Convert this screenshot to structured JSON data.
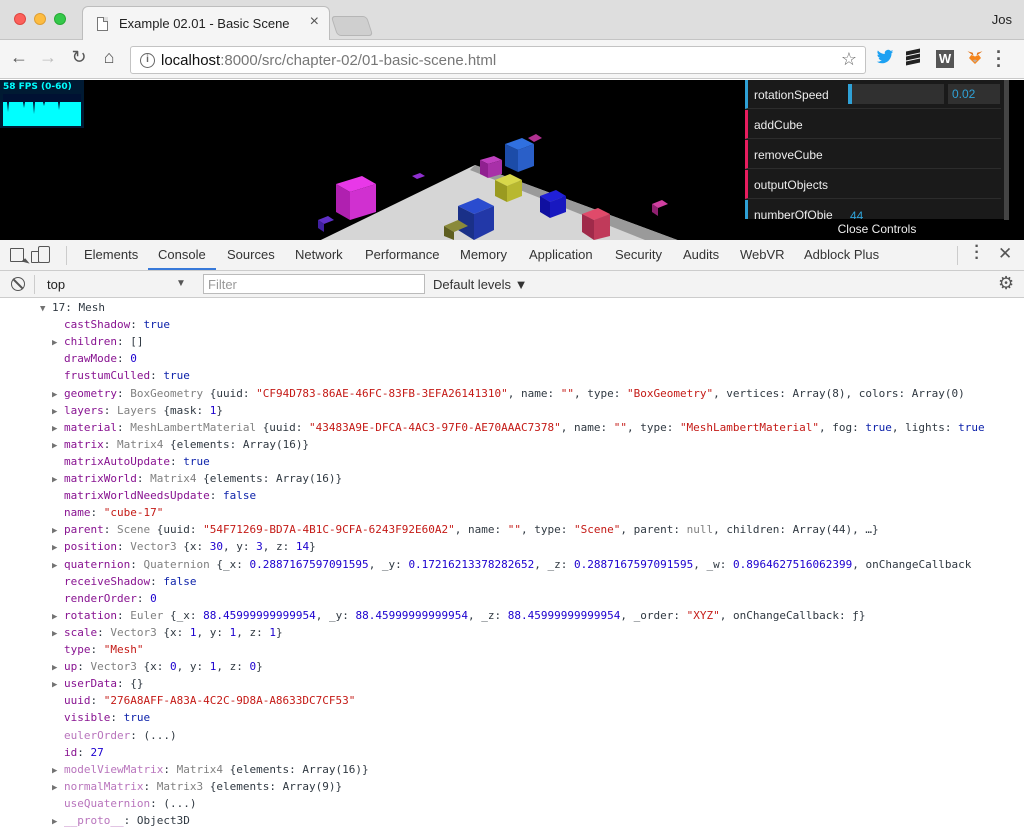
{
  "window": {
    "tab_title": "Example 02.01 - Basic Scene",
    "tab_close": "×",
    "profile": "Jos"
  },
  "toolbar": {
    "back": "←",
    "forward": "→",
    "reload": "↻",
    "home": "⌂",
    "url_host": "localhost",
    "url_rest": ":8000/src/chapter-02/01-basic-scene.html",
    "info": "i",
    "star": "☆",
    "ext_w": "W",
    "menu": "⋮"
  },
  "stats": {
    "fps_label": "58 FPS (0-60)"
  },
  "gui": {
    "rows": [
      {
        "label": "rotationSpeed",
        "type": "number",
        "value": "0.02",
        "fill": 0.04
      },
      {
        "label": "addCube",
        "type": "function"
      },
      {
        "label": "removeCube",
        "type": "function"
      },
      {
        "label": "outputObjects",
        "type": "function"
      },
      {
        "label": "numberOfObje",
        "type": "number",
        "value": "44"
      }
    ],
    "close_label": "Close Controls",
    "colors": {
      "number": "#2fa1d6",
      "function": "#e61d5f"
    }
  },
  "devtools": {
    "tabs": [
      "Elements",
      "Console",
      "Sources",
      "Network",
      "Performance",
      "Memory",
      "Application",
      "Security",
      "Audits",
      "WebVR",
      "Adblock Plus"
    ],
    "active_tab": "Console",
    "more": "⋮",
    "close": "✕"
  },
  "console_bar": {
    "context": "top",
    "context_arrow": "▼",
    "filter_placeholder": "Filter",
    "levels": "Default levels ▼",
    "gear": "⚙"
  },
  "console_lines": [
    {
      "indent": 40,
      "arrow": "▼",
      "parts": [
        [
          "t",
          "17: Mesh"
        ]
      ]
    },
    {
      "indent": 52,
      "arrow": "",
      "parts": [
        [
          "k",
          "castShadow"
        ],
        [
          "t",
          ": "
        ],
        [
          "b",
          "true"
        ]
      ]
    },
    {
      "indent": 52,
      "arrow": "▶",
      "parts": [
        [
          "k",
          "children"
        ],
        [
          "t",
          ": []"
        ]
      ]
    },
    {
      "indent": 52,
      "arrow": "",
      "parts": [
        [
          "k",
          "drawMode"
        ],
        [
          "t",
          ": "
        ],
        [
          "n",
          "0"
        ]
      ]
    },
    {
      "indent": 52,
      "arrow": "",
      "parts": [
        [
          "k",
          "frustumCulled"
        ],
        [
          "t",
          ": "
        ],
        [
          "b",
          "true"
        ]
      ]
    },
    {
      "indent": 52,
      "arrow": "▶",
      "parts": [
        [
          "k",
          "geometry"
        ],
        [
          "t",
          ": "
        ],
        [
          "nl",
          "BoxGeometry "
        ],
        [
          "t",
          "{uuid: "
        ],
        [
          "s",
          "\"CF94D783-86AE-46FC-83FB-3EFA26141310\""
        ],
        [
          "t",
          ", name: "
        ],
        [
          "s",
          "\"\""
        ],
        [
          "t",
          ", type: "
        ],
        [
          "s",
          "\"BoxGeometry\""
        ],
        [
          "t",
          ", vertices: Array(8), colors: Array(0)"
        ]
      ]
    },
    {
      "indent": 52,
      "arrow": "▶",
      "parts": [
        [
          "k",
          "layers"
        ],
        [
          "t",
          ": "
        ],
        [
          "nl",
          "Layers "
        ],
        [
          "t",
          "{mask: "
        ],
        [
          "n",
          "1"
        ],
        [
          "t",
          "}"
        ]
      ]
    },
    {
      "indent": 52,
      "arrow": "▶",
      "parts": [
        [
          "k",
          "material"
        ],
        [
          "t",
          ": "
        ],
        [
          "nl",
          "MeshLambertMaterial "
        ],
        [
          "t",
          "{uuid: "
        ],
        [
          "s",
          "\"43483A9E-DFCA-4AC3-97F0-AE70AAAC7378\""
        ],
        [
          "t",
          ", name: "
        ],
        [
          "s",
          "\"\""
        ],
        [
          "t",
          ", type: "
        ],
        [
          "s",
          "\"MeshLambertMaterial\""
        ],
        [
          "t",
          ", fog: "
        ],
        [
          "b",
          "true"
        ],
        [
          "t",
          ", lights: "
        ],
        [
          "b",
          "true"
        ]
      ]
    },
    {
      "indent": 52,
      "arrow": "▶",
      "parts": [
        [
          "k",
          "matrix"
        ],
        [
          "t",
          ": "
        ],
        [
          "nl",
          "Matrix4 "
        ],
        [
          "t",
          "{elements: Array(16)}"
        ]
      ]
    },
    {
      "indent": 52,
      "arrow": "",
      "parts": [
        [
          "k",
          "matrixAutoUpdate"
        ],
        [
          "t",
          ": "
        ],
        [
          "b",
          "true"
        ]
      ]
    },
    {
      "indent": 52,
      "arrow": "▶",
      "parts": [
        [
          "k",
          "matrixWorld"
        ],
        [
          "t",
          ": "
        ],
        [
          "nl",
          "Matrix4 "
        ],
        [
          "t",
          "{elements: Array(16)}"
        ]
      ]
    },
    {
      "indent": 52,
      "arrow": "",
      "parts": [
        [
          "k",
          "matrixWorldNeedsUpdate"
        ],
        [
          "t",
          ": "
        ],
        [
          "b",
          "false"
        ]
      ]
    },
    {
      "indent": 52,
      "arrow": "",
      "parts": [
        [
          "k",
          "name"
        ],
        [
          "t",
          ": "
        ],
        [
          "s",
          "\"cube-17\""
        ]
      ]
    },
    {
      "indent": 52,
      "arrow": "▶",
      "parts": [
        [
          "k",
          "parent"
        ],
        [
          "t",
          ": "
        ],
        [
          "nl",
          "Scene "
        ],
        [
          "t",
          "{uuid: "
        ],
        [
          "s",
          "\"54F71269-BD7A-4B1C-9CFA-6243F92E60A2\""
        ],
        [
          "t",
          ", name: "
        ],
        [
          "s",
          "\"\""
        ],
        [
          "t",
          ", type: "
        ],
        [
          "s",
          "\"Scene\""
        ],
        [
          "t",
          ", parent: "
        ],
        [
          "nl",
          "null"
        ],
        [
          "t",
          ", children: Array(44), …}"
        ]
      ]
    },
    {
      "indent": 52,
      "arrow": "▶",
      "parts": [
        [
          "k",
          "position"
        ],
        [
          "t",
          ": "
        ],
        [
          "nl",
          "Vector3 "
        ],
        [
          "t",
          "{x: "
        ],
        [
          "n",
          "30"
        ],
        [
          "t",
          ", y: "
        ],
        [
          "n",
          "3"
        ],
        [
          "t",
          ", z: "
        ],
        [
          "n",
          "14"
        ],
        [
          "t",
          "}"
        ]
      ]
    },
    {
      "indent": 52,
      "arrow": "▶",
      "parts": [
        [
          "k",
          "quaternion"
        ],
        [
          "t",
          ": "
        ],
        [
          "nl",
          "Quaternion "
        ],
        [
          "t",
          "{_x: "
        ],
        [
          "n",
          "0.2887167597091595"
        ],
        [
          "t",
          ", _y: "
        ],
        [
          "n",
          "0.17216213378282652"
        ],
        [
          "t",
          ", _z: "
        ],
        [
          "n",
          "0.2887167597091595"
        ],
        [
          "t",
          ", _w: "
        ],
        [
          "n",
          "0.8964627516062399"
        ],
        [
          "t",
          ", onChangeCallback"
        ]
      ]
    },
    {
      "indent": 52,
      "arrow": "",
      "parts": [
        [
          "k",
          "receiveShadow"
        ],
        [
          "t",
          ": "
        ],
        [
          "b",
          "false"
        ]
      ]
    },
    {
      "indent": 52,
      "arrow": "",
      "parts": [
        [
          "k",
          "renderOrder"
        ],
        [
          "t",
          ": "
        ],
        [
          "n",
          "0"
        ]
      ]
    },
    {
      "indent": 52,
      "arrow": "▶",
      "parts": [
        [
          "k",
          "rotation"
        ],
        [
          "t",
          ": "
        ],
        [
          "nl",
          "Euler "
        ],
        [
          "t",
          "{_x: "
        ],
        [
          "n",
          "88.45999999999954"
        ],
        [
          "t",
          ", _y: "
        ],
        [
          "n",
          "88.45999999999954"
        ],
        [
          "t",
          ", _z: "
        ],
        [
          "n",
          "88.45999999999954"
        ],
        [
          "t",
          ", _order: "
        ],
        [
          "s",
          "\"XYZ\""
        ],
        [
          "t",
          ", onChangeCallback: "
        ],
        [
          "t",
          "ƒ}"
        ]
      ]
    },
    {
      "indent": 52,
      "arrow": "▶",
      "parts": [
        [
          "k",
          "scale"
        ],
        [
          "t",
          ": "
        ],
        [
          "nl",
          "Vector3 "
        ],
        [
          "t",
          "{x: "
        ],
        [
          "n",
          "1"
        ],
        [
          "t",
          ", y: "
        ],
        [
          "n",
          "1"
        ],
        [
          "t",
          ", z: "
        ],
        [
          "n",
          "1"
        ],
        [
          "t",
          "}"
        ]
      ]
    },
    {
      "indent": 52,
      "arrow": "",
      "parts": [
        [
          "k",
          "type"
        ],
        [
          "t",
          ": "
        ],
        [
          "s",
          "\"Mesh\""
        ]
      ]
    },
    {
      "indent": 52,
      "arrow": "▶",
      "parts": [
        [
          "k",
          "up"
        ],
        [
          "t",
          ": "
        ],
        [
          "nl",
          "Vector3 "
        ],
        [
          "t",
          "{x: "
        ],
        [
          "n",
          "0"
        ],
        [
          "t",
          ", y: "
        ],
        [
          "n",
          "1"
        ],
        [
          "t",
          ", z: "
        ],
        [
          "n",
          "0"
        ],
        [
          "t",
          "}"
        ]
      ]
    },
    {
      "indent": 52,
      "arrow": "▶",
      "parts": [
        [
          "k",
          "userData"
        ],
        [
          "t",
          ": {}"
        ]
      ]
    },
    {
      "indent": 52,
      "arrow": "",
      "parts": [
        [
          "k",
          "uuid"
        ],
        [
          "t",
          ": "
        ],
        [
          "s",
          "\"276A8AFF-A83A-4C2C-9D8A-A8633DC7CF53\""
        ]
      ]
    },
    {
      "indent": 52,
      "arrow": "",
      "parts": [
        [
          "k",
          "visible"
        ],
        [
          "t",
          ": "
        ],
        [
          "b",
          "true"
        ]
      ]
    },
    {
      "indent": 52,
      "arrow": "",
      "parts": [
        [
          "kd",
          "eulerOrder"
        ],
        [
          "t",
          ": (...)"
        ]
      ]
    },
    {
      "indent": 52,
      "arrow": "",
      "parts": [
        [
          "k",
          "id"
        ],
        [
          "t",
          ": "
        ],
        [
          "n",
          "27"
        ]
      ]
    },
    {
      "indent": 52,
      "arrow": "▶",
      "parts": [
        [
          "kd",
          "modelViewMatrix"
        ],
        [
          "t",
          ": "
        ],
        [
          "nl",
          "Matrix4 "
        ],
        [
          "t",
          "{elements: Array(16)}"
        ]
      ]
    },
    {
      "indent": 52,
      "arrow": "▶",
      "parts": [
        [
          "kd",
          "normalMatrix"
        ],
        [
          "t",
          ": "
        ],
        [
          "nl",
          "Matrix3 "
        ],
        [
          "t",
          "{elements: Array(9)}"
        ]
      ]
    },
    {
      "indent": 52,
      "arrow": "",
      "parts": [
        [
          "kd",
          "useQuaternion"
        ],
        [
          "t",
          ": (...)"
        ]
      ]
    },
    {
      "indent": 52,
      "arrow": "▶",
      "parts": [
        [
          "kd",
          "__proto__"
        ],
        [
          "t",
          ": Object3D"
        ]
      ]
    }
  ]
}
